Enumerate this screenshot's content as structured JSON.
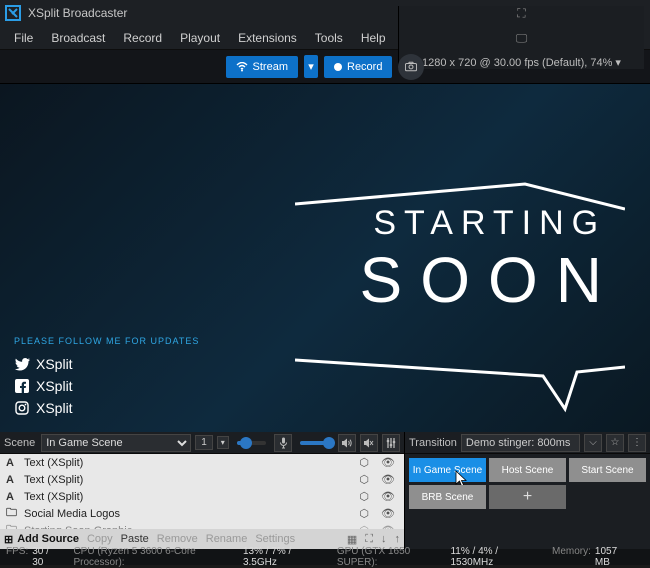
{
  "window": {
    "title": "XSplit Broadcaster"
  },
  "menu": {
    "items": [
      "File",
      "Broadcast",
      "Record",
      "Playout",
      "Extensions",
      "Tools",
      "Help"
    ],
    "resolution": "1280 x 720 @ 30.00 fps (Default), 74%"
  },
  "actions": {
    "stream": "Stream",
    "record": "Record"
  },
  "preview": {
    "line1": "STARTING",
    "line2": "SOON",
    "follow": "PLEASE FOLLOW ME FOR UPDATES",
    "socials": [
      {
        "icon": "twitter",
        "label": "XSplit"
      },
      {
        "icon": "facebook",
        "label": "XSplit"
      },
      {
        "icon": "instagram",
        "label": "XSplit"
      }
    ]
  },
  "scenebar": {
    "label": "Scene",
    "selected": "In Game Scene",
    "preset": "1"
  },
  "audio": {
    "mic_level": 30,
    "out_level": 95
  },
  "sources": [
    {
      "icon": "A",
      "name": "Text (XSplit)"
    },
    {
      "icon": "A",
      "name": "Text (XSplit)"
    },
    {
      "icon": "A",
      "name": "Text (XSplit)"
    },
    {
      "icon": "folder",
      "name": "Social Media Logos"
    },
    {
      "icon": "folder",
      "name": "Starting Soon Graphic"
    }
  ],
  "srctools": {
    "add": "Add Source",
    "copy": "Copy",
    "paste": "Paste",
    "remove": "Remove",
    "rename": "Rename",
    "settings": "Settings"
  },
  "transition": {
    "label": "Transition",
    "selected": "Demo stinger: 800ms"
  },
  "scenes": [
    {
      "label": "In Game Scene",
      "active": true
    },
    {
      "label": "Host Scene",
      "active": false
    },
    {
      "label": "Start Scene",
      "active": false
    },
    {
      "label": "BRB Scene",
      "active": false
    }
  ],
  "status": {
    "fps_label": "FPS:",
    "fps": "30 / 30",
    "cpu_label": "CPU (Ryzen 5 3600 6-Core Processor):",
    "cpu": "13% / 7% / 3.5GHz",
    "gpu_label": "GPU (GTX 1650 SUPER):",
    "gpu": "11% / 4% / 1530MHz",
    "mem_label": "Memory:",
    "mem": "1057 MB"
  }
}
